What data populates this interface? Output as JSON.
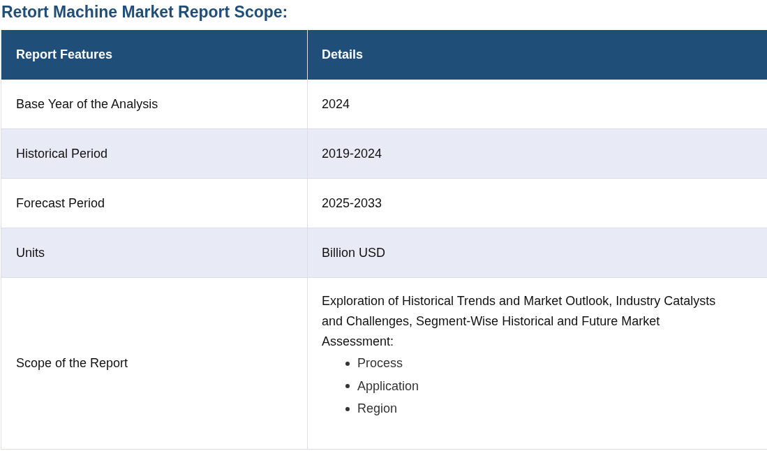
{
  "title": "Retort Machine Market Report Scope:",
  "table": {
    "columns": [
      "Report Features",
      "Details"
    ],
    "rows": [
      {
        "feature": "Base Year of the Analysis",
        "details": "2024"
      },
      {
        "feature": "Historical Period",
        "details": "2019-2024"
      },
      {
        "feature": "Forecast Period",
        "details": "2025-2033"
      },
      {
        "feature": "Units",
        "details": "Billion USD"
      },
      {
        "feature": "Scope of the Report",
        "details": "Exploration of Historical Trends and Market Outlook, Industry Catalysts and Challenges, Segment-Wise Historical and Future Market Assessment:",
        "bullets": [
          "Process",
          "Application",
          "Region"
        ]
      }
    ]
  }
}
